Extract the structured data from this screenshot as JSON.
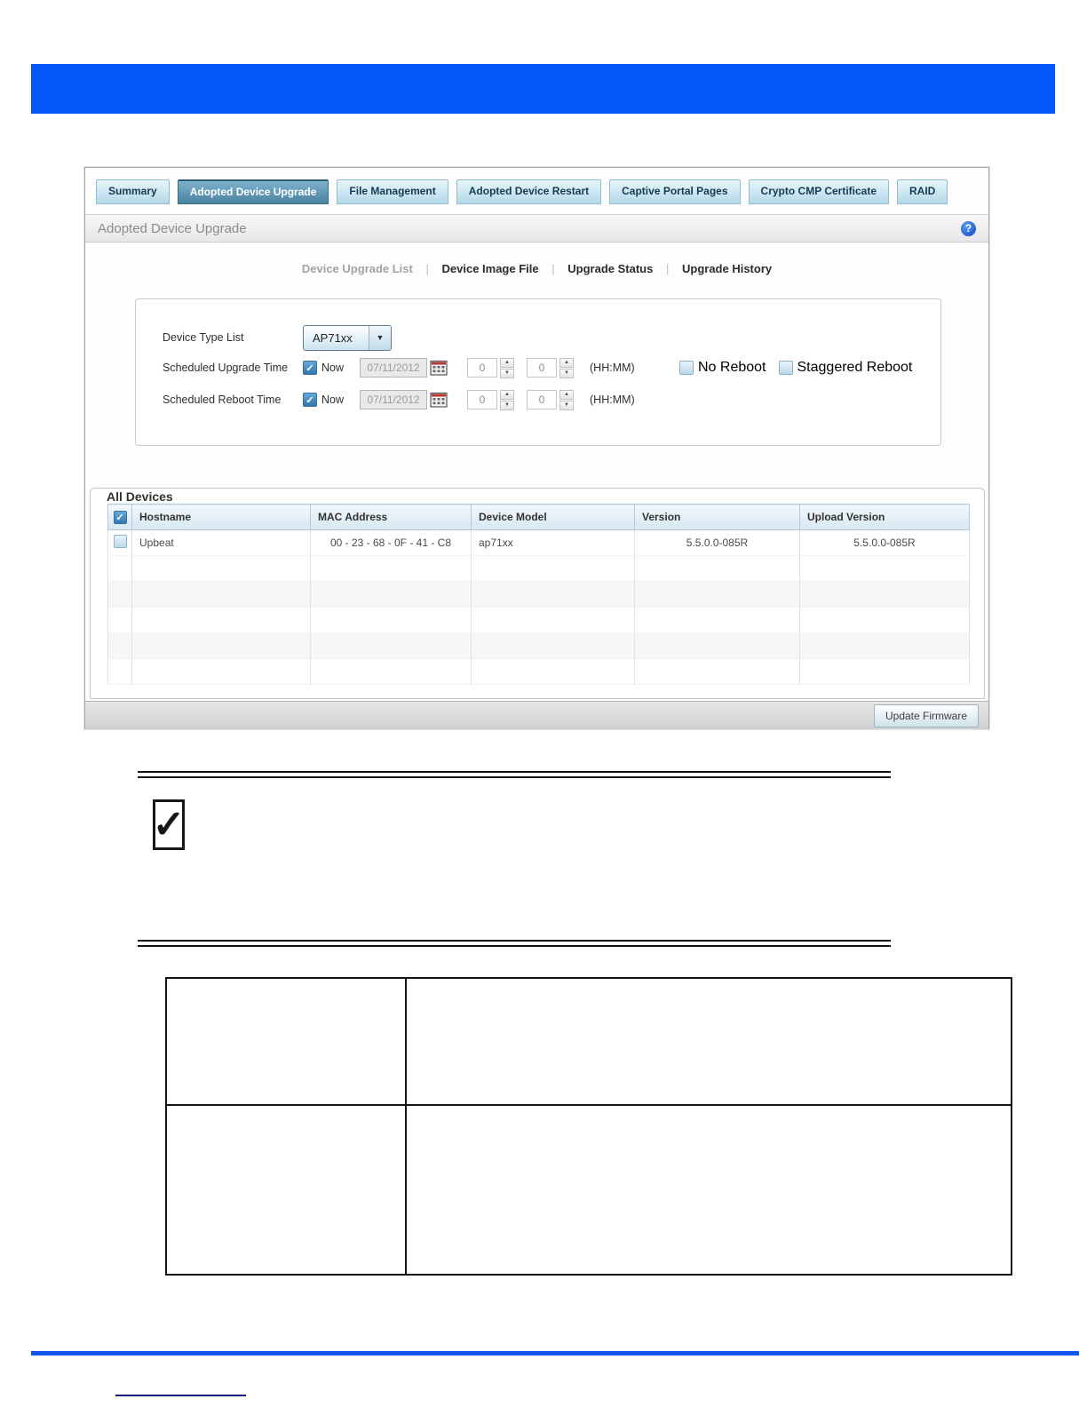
{
  "glyphs": {
    "check": "✓",
    "arrow_down": "▼",
    "spinner_up": "▲",
    "spinner_down": "▼",
    "question": "?"
  },
  "app": {
    "tabs": [
      "Summary",
      "Adopted Device Upgrade",
      "File Management",
      "Adopted Device Restart",
      "Captive Portal Pages",
      "Crypto CMP Certificate",
      "RAID"
    ],
    "active_tab": "Adopted Device Upgrade",
    "title": "Adopted Device Upgrade",
    "subnav": {
      "items": [
        "Device Upgrade List",
        "Device Image File",
        "Upgrade Status",
        "Upgrade History"
      ],
      "active": "Device Upgrade List",
      "separator": "|"
    },
    "form": {
      "device_type_label": "Device Type List",
      "device_type_value": "AP71xx",
      "scheduled_upgrade_label": "Scheduled Upgrade Time",
      "scheduled_reboot_label": "Scheduled Reboot Time",
      "now_label": "Now",
      "now_upgrade_checked": true,
      "now_reboot_checked": true,
      "upgrade_date": "07/11/2012",
      "reboot_date": "07/11/2012",
      "upgrade_hour": "0",
      "upgrade_minute": "0",
      "reboot_hour": "0",
      "reboot_minute": "0",
      "time_format_label": "(HH:MM)",
      "no_reboot_label": "No Reboot",
      "no_reboot_checked": false,
      "staggered_reboot_label": "Staggered Reboot",
      "staggered_reboot_checked": false
    },
    "devices": {
      "title": "All Devices",
      "header_checkbox_checked": true,
      "columns": [
        "Hostname",
        "MAC Address",
        "Device Model",
        "Version",
        "Upload Version"
      ],
      "rows": [
        {
          "selected": false,
          "hostname": "Upbeat",
          "mac": "00 - 23 - 68 - 0F - 41 - C8",
          "model": "ap71xx",
          "version": "5.5.0.0-085R",
          "upload_version": "5.5.0.0-085R"
        }
      ],
      "empty_rows": 5
    },
    "footer": {
      "update_button_label": "Update Firmware"
    }
  },
  "note": {
    "check_glyph": "✓"
  },
  "colors": {
    "banner_blue": "#0356fa",
    "rule_blue": "#0d57ee",
    "tab_active_blue": "#47829f",
    "tab_inactive_blue": "#b4d8e9",
    "help_icon_blue": "#0d47c4",
    "checkbox_blue": "#2e77b0",
    "footnote_navy": "#15157a"
  }
}
